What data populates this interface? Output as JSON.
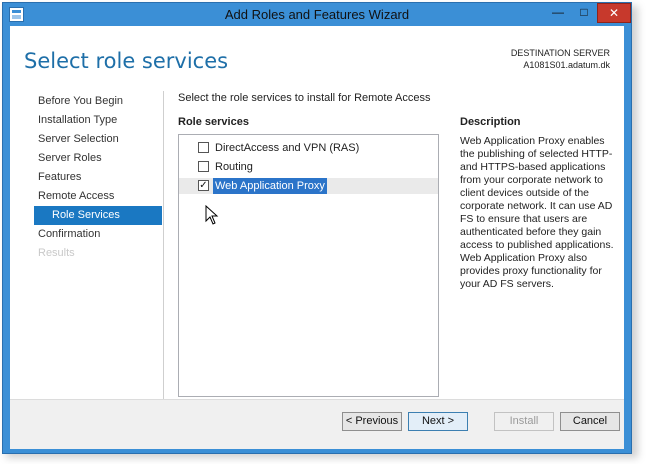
{
  "window": {
    "title": "Add Roles and Features Wizard",
    "minimize_glyph": "—",
    "maximize_glyph": "□",
    "close_glyph": "✕"
  },
  "header": {
    "page_title": "Select role services",
    "destination_label": "DESTINATION SERVER",
    "destination_server": "A1081S01.adatum.dk"
  },
  "nav": {
    "items": [
      {
        "label": "Before You Begin",
        "state": "normal"
      },
      {
        "label": "Installation Type",
        "state": "normal"
      },
      {
        "label": "Server Selection",
        "state": "normal"
      },
      {
        "label": "Server Roles",
        "state": "normal"
      },
      {
        "label": "Features",
        "state": "normal"
      },
      {
        "label": "Remote Access",
        "state": "normal"
      },
      {
        "label": "Role Services",
        "state": "active"
      },
      {
        "label": "Confirmation",
        "state": "normal"
      },
      {
        "label": "Results",
        "state": "disabled"
      }
    ]
  },
  "main": {
    "instruction": "Select the role services to install for Remote Access",
    "role_services_header": "Role services",
    "role_services": [
      {
        "label": "DirectAccess and VPN (RAS)",
        "checked": false,
        "checkmark": ""
      },
      {
        "label": "Routing",
        "checked": false,
        "checkmark": ""
      },
      {
        "label": "Web Application Proxy",
        "checked": true,
        "checkmark": "✓"
      }
    ]
  },
  "description": {
    "header": "Description",
    "text": "Web Application Proxy enables the publishing of selected HTTP- and HTTPS-based applications from your corporate network to client devices outside of the corporate network. It can use AD FS to ensure that users are authenticated before they gain access to published applications. Web Application Proxy also provides proxy functionality for your AD FS servers."
  },
  "footer": {
    "previous_label": "< Previous",
    "next_label": "Next >",
    "install_label": "Install",
    "cancel_label": "Cancel"
  },
  "colors": {
    "title_bar": "#3b8fd6",
    "accent": "#1a78c2",
    "page_title": "#1e6fa8",
    "close_button": "#c7392c"
  }
}
